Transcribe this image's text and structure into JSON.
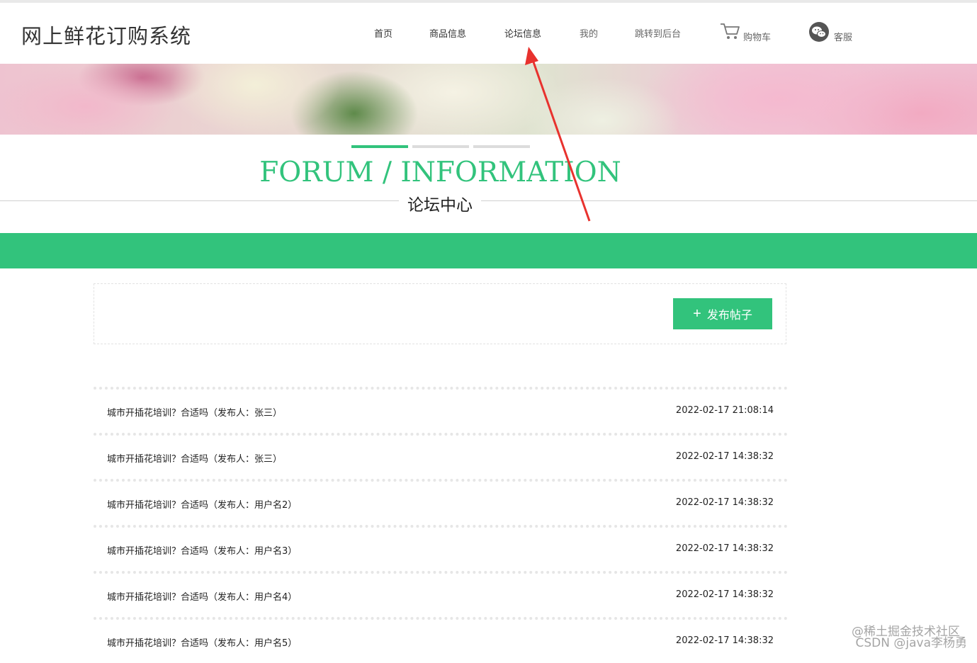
{
  "site": {
    "title": "网上鲜花订购系统"
  },
  "nav": {
    "items": [
      {
        "label": "首页"
      },
      {
        "label": "商品信息"
      },
      {
        "label": "论坛信息"
      },
      {
        "label": "我的"
      },
      {
        "label": "跳转到后台"
      }
    ],
    "cart_label": "购物车",
    "service_label": "客服",
    "icons": {
      "cart": "cart-icon",
      "service": "wechat-icon"
    }
  },
  "banner": {
    "slide_count": 3,
    "active_slide": 1
  },
  "section": {
    "title_en": "FORUM / INFORMATION",
    "title_cn": "论坛中心"
  },
  "actions": {
    "post_label": "发布帖子",
    "post_icon": "plus-icon"
  },
  "posts": [
    {
      "title": "城市开插花培训？合适吗（发布人：张三）",
      "time": "2022-02-17 21:08:14"
    },
    {
      "title": "城市开插花培训？合适吗（发布人：张三）",
      "time": "2022-02-17 14:38:32"
    },
    {
      "title": "城市开插花培训？合适吗（发布人：用户名2）",
      "time": "2022-02-17 14:38:32"
    },
    {
      "title": "城市开插花培训？合适吗（发布人：用户名3）",
      "time": "2022-02-17 14:38:32"
    },
    {
      "title": "城市开插花培训？合适吗（发布人：用户名4）",
      "time": "2022-02-17 14:38:32"
    },
    {
      "title": "城市开插花培训？合适吗（发布人：用户名5）",
      "time": "2022-02-17 14:38:32"
    }
  ],
  "watermark": {
    "line1": "@稀土掘金技术社区",
    "line2": "CSDN @java李杨勇"
  },
  "colors": {
    "accent": "#32c37c",
    "annotation_arrow": "#e8322e"
  }
}
